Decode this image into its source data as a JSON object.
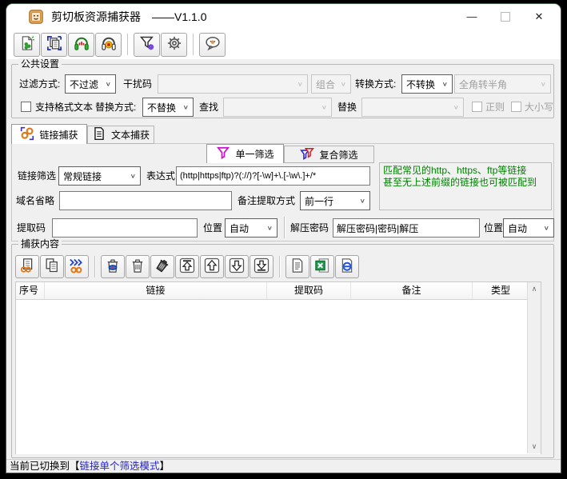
{
  "titlebar": {
    "app_name": "剪切板资源捕获器",
    "version": "——V1.1.0",
    "minimize_glyph": "—",
    "close_glyph": "✕"
  },
  "main_toolbar": {
    "buttons": [
      "new-document",
      "paste-copy",
      "monitor-on",
      "monitor-off",
      "filter-settings",
      "settings",
      "about-message"
    ]
  },
  "common_settings": {
    "title": "公共设置",
    "filter_mode_label": "过滤方式:",
    "filter_mode_value": "不过滤",
    "noise_code_label": "干扰码",
    "noise_code_value": "",
    "combine_value": "组合",
    "convert_mode_label": "转换方式:",
    "convert_mode_value": "不转换",
    "width_convert_value": "全角转半角",
    "rich_text_checkbox_label": "支持格式文本",
    "replace_mode_label": "替换方式:",
    "replace_mode_value": "不替换",
    "find_label": "查找",
    "find_value": "",
    "replace_label": "替换",
    "replace_value": "",
    "regex_checkbox_label": "正则",
    "case_checkbox_label": "大小写"
  },
  "capture_tabs": {
    "link_tab": "链接捕获",
    "text_tab": "文本捕获"
  },
  "filter_tabs": {
    "single": "单一筛选",
    "composite": "复合筛选"
  },
  "link_panel": {
    "link_filter_label": "链接筛选",
    "link_filter_value": "常规链接",
    "expression_label": "表达式",
    "expression_value": "(http|https|ftp)?(://)?[-\\w]+\\.[-\\w\\.]+/*",
    "hint_line1": "匹配常见的http、https、ftp等链接",
    "hint_line2": "甚至无上述前缀的链接也可被匹配到",
    "domain_omit_label": "域名省略",
    "domain_omit_value": "",
    "note_mode_label": "备注提取方式",
    "note_mode_value": "前一行",
    "extract_code_label": "提取码",
    "extract_code_value": "",
    "position1_label": "位置",
    "position1_value": "自动",
    "unzip_label": "解压密码",
    "unzip_value": "解压密码|密码|解压",
    "position2_label": "位置",
    "position2_value": "自动"
  },
  "capture_content": {
    "title": "捕获内容",
    "toolbar_buttons": [
      "copy-link",
      "copy-all",
      "open-links",
      "delete-link",
      "delete-row",
      "clear-all",
      "move-top",
      "move-up",
      "move-down",
      "move-bottom",
      "export-text",
      "export-excel",
      "export-html"
    ],
    "table": {
      "columns": [
        "序号",
        "链接",
        "提取码",
        "备注",
        "类型"
      ],
      "rows": []
    }
  },
  "statusbar": {
    "prefix": "当前已切换到【",
    "mode": "链接单个筛选模式",
    "suffix": "】"
  },
  "icons": {
    "chevron_down": "∨",
    "scroll_up": "∧",
    "scroll_down": "∨"
  },
  "colors": {
    "hint_text": "#008000",
    "status_mode": "#2222cc",
    "chain_orange": "#e07818",
    "funnel_magenta": "#c818c8",
    "excel_green": "#1f9c4d"
  }
}
